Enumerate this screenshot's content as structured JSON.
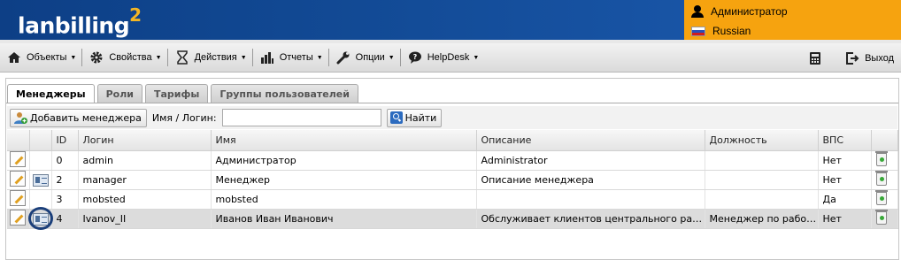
{
  "header": {
    "logo_text": "lanbilling",
    "logo_sup": "2",
    "user_name": "Администратор",
    "language": "Russian"
  },
  "menu": {
    "items": [
      {
        "label": "Объекты",
        "icon": "home-icon"
      },
      {
        "label": "Свойства",
        "icon": "gear-icon"
      },
      {
        "label": "Действия",
        "icon": "hourglass-icon"
      },
      {
        "label": "Отчеты",
        "icon": "bar-chart-icon"
      },
      {
        "label": "Опции",
        "icon": "wrench-icon"
      },
      {
        "label": "HelpDesk",
        "icon": "chat-bubble-icon"
      }
    ],
    "logout_label": "Выход"
  },
  "tabs": [
    {
      "label": "Менеджеры",
      "active": true
    },
    {
      "label": "Роли",
      "active": false
    },
    {
      "label": "Тарифы",
      "active": false
    },
    {
      "label": "Группы пользователей",
      "active": false
    }
  ],
  "toolbar": {
    "add_label": "Добавить менеджера",
    "filter_label": "Имя / Логин:",
    "filter_value": "",
    "find_label": "Найти"
  },
  "table": {
    "columns": [
      "ID",
      "Логин",
      "Имя",
      "Описание",
      "Должность",
      "ВПС"
    ],
    "rows": [
      {
        "id": "0",
        "login": "admin",
        "name": "Администратор",
        "description": "Administrator",
        "position": "",
        "vps": "Нет",
        "has_card": false,
        "selected": false
      },
      {
        "id": "2",
        "login": "manager",
        "name": "Менеджер",
        "description": "Описание менеджера",
        "position": "",
        "vps": "Нет",
        "has_card": true,
        "selected": false
      },
      {
        "id": "3",
        "login": "mobsted",
        "name": "mobsted",
        "description": "",
        "position": "",
        "vps": "Да",
        "has_card": false,
        "selected": false
      },
      {
        "id": "4",
        "login": "Ivanov_II",
        "name": "Иванов Иван Иванович",
        "description": "Обслуживает клиентов центрального района",
        "position": "Менеджер по работе...",
        "vps": "Нет",
        "has_card": true,
        "selected": true
      }
    ]
  },
  "colors": {
    "header_blue": "#124a95",
    "user_box_orange": "#f6a30f",
    "logo_accent": "#f4b624"
  }
}
